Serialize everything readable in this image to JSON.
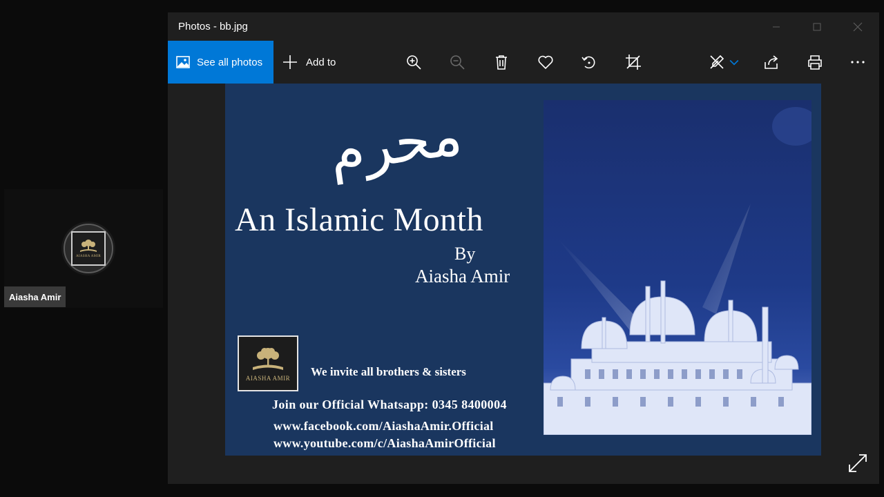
{
  "participant": {
    "name": "Aiasha Amir",
    "logo_text": "AIASHA AMIR"
  },
  "window": {
    "title": "Photos - bb.jpg",
    "controls": {
      "minimize": "—",
      "maximize": "☐",
      "close": "✕"
    }
  },
  "toolbar": {
    "see_all_label": "See all photos",
    "add_to_label": "Add to",
    "icons": [
      "zoom-in-icon",
      "zoom-out-icon",
      "delete-icon",
      "favorite-icon",
      "rotate-icon",
      "crop-icon",
      "edit-icon",
      "share-icon",
      "print-icon",
      "more-icon"
    ]
  },
  "image": {
    "arabic_title": "محرم",
    "headline": "An Islamic Month",
    "by": "By",
    "author": "Aiasha Amir",
    "logo_text": "AIASHA AMIR",
    "invite": "We invite all brothers & sisters",
    "whatsapp": "Join our Official Whatsapp: 0345 8400004",
    "facebook": "www.facebook.com/AiashaAmir.Official",
    "youtube": "www.youtube.com/c/AiashaAmirOfficial"
  },
  "colors": {
    "accent": "#0078d7",
    "image_bg": "#1a365f",
    "logo_gold": "#c8b27a"
  }
}
